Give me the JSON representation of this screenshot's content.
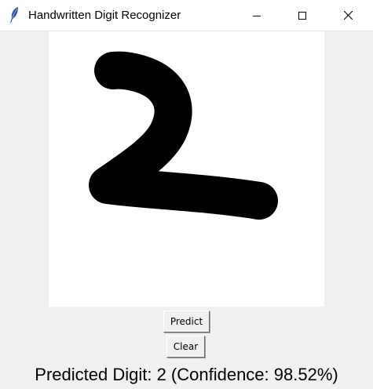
{
  "window": {
    "title": "Handwritten Digit Recognizer",
    "app_icon": "feather-icon",
    "controls": [
      "minimize-icon",
      "maximize-icon",
      "close-icon"
    ]
  },
  "canvas": {
    "background": "#ffffff",
    "stroke_color": "#000000",
    "drawn_content": "digit-2-stroke"
  },
  "buttons": {
    "predict_label": "Predict",
    "clear_label": "Clear"
  },
  "result": {
    "text": "Predicted Digit: 2 (Confidence: 98.52%)"
  },
  "colors": {
    "window_background": "#f0f0f0",
    "titlebar_background": "#ffffff"
  }
}
